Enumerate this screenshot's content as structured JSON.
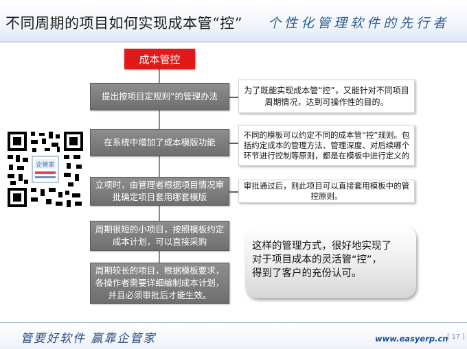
{
  "header": {
    "title": "不同周期的项目如何实现成本管“控”",
    "slogan": "个性化管理软件的先行者"
  },
  "root": {
    "label": "成本管控"
  },
  "steps": [
    {
      "label": "提出按项目定规则”的管理办法"
    },
    {
      "label": "在系统中增加了成本模版功能"
    },
    {
      "label": "立项时，由管理者根据项目情况审批确定项目套用哪套模版"
    },
    {
      "label": "周期很短的小项目，按照模板约定成本计划，可以直接采购"
    },
    {
      "label": "周期较长的项目，根据模板要求，各操作者需要详细编制成本计划，并且必须审批后才能生效。"
    }
  ],
  "notes": [
    {
      "text": "为了既能实现成本管“控”，又能针对不同项目周期情况，达到可操作性的目的。"
    },
    {
      "text": "不同的模板可以约定不同的成本管“控”规则。包括约定成本的管理方法、管理深度、对后续哪个环节进行控制等原则，都是在模板中进行定义的"
    },
    {
      "text": "审批通过后，则此项目可以直接套用模板中的管控原则。"
    }
  ],
  "summary": {
    "line1": "这样的管理方式，很好地实现了",
    "line2": "对于项目成本的灵活管“控”，",
    "line3": "得到了客户的充份认可。"
  },
  "footer": {
    "slogan": "管要好软件 赢靠企管家",
    "url": "www.easyerp.cn",
    "page": "[ 17 ]"
  },
  "colors": {
    "root_red": "#e01a1a",
    "step_gray": "#7a7a7a",
    "brand_blue": "#1a4f9c"
  }
}
